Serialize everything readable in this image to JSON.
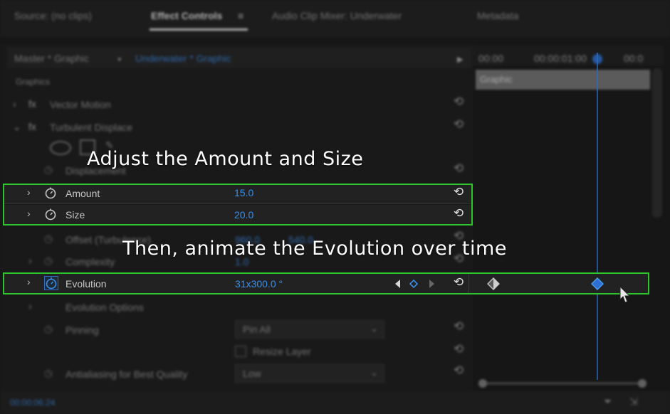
{
  "tabs": [
    {
      "label": "Source: (no clips)"
    },
    {
      "label": "Effect Controls"
    },
    {
      "label": "Audio Clip Mixer: Underwater"
    },
    {
      "label": "Metadata"
    }
  ],
  "tab_close": "≡",
  "clip_header": {
    "master": "Master * Graphic",
    "clip": "Underwater * Graphic"
  },
  "timeline": {
    "ruler": [
      "00:00",
      "00:00:01:00",
      "00:0"
    ],
    "track_label": "Graphic"
  },
  "effects": {
    "section": "Graphics",
    "vector_motion": "Vector Motion",
    "turbulent_displace": "Turbulent Displace",
    "displacement": "Displacement",
    "amount": {
      "label": "Amount",
      "value": "15.0"
    },
    "size": {
      "label": "Size",
      "value": "20.0"
    },
    "offset": {
      "label": "Offset (Turbulence)",
      "x": "960.0",
      "y": "540.0"
    },
    "complexity": {
      "label": "Complexity",
      "value": "1.0"
    },
    "evolution": {
      "label": "Evolution",
      "value": "31x300.0 °"
    },
    "evolution_options": "Evolution Options",
    "pinning": {
      "label": "Pinning",
      "value": "Pin All"
    },
    "resize_layer": "Resize Layer",
    "antialiasing": {
      "label": "Antialiasing for Best Quality",
      "value": "Low"
    }
  },
  "statusbar": {
    "timecode": "00:00:06:24"
  },
  "annotations": {
    "first": "Adjust the Amount and Size",
    "second": "Then, animate the Evolution over time"
  },
  "colors": {
    "highlight": "#2ec42e",
    "accent": "#3a8ee6"
  }
}
